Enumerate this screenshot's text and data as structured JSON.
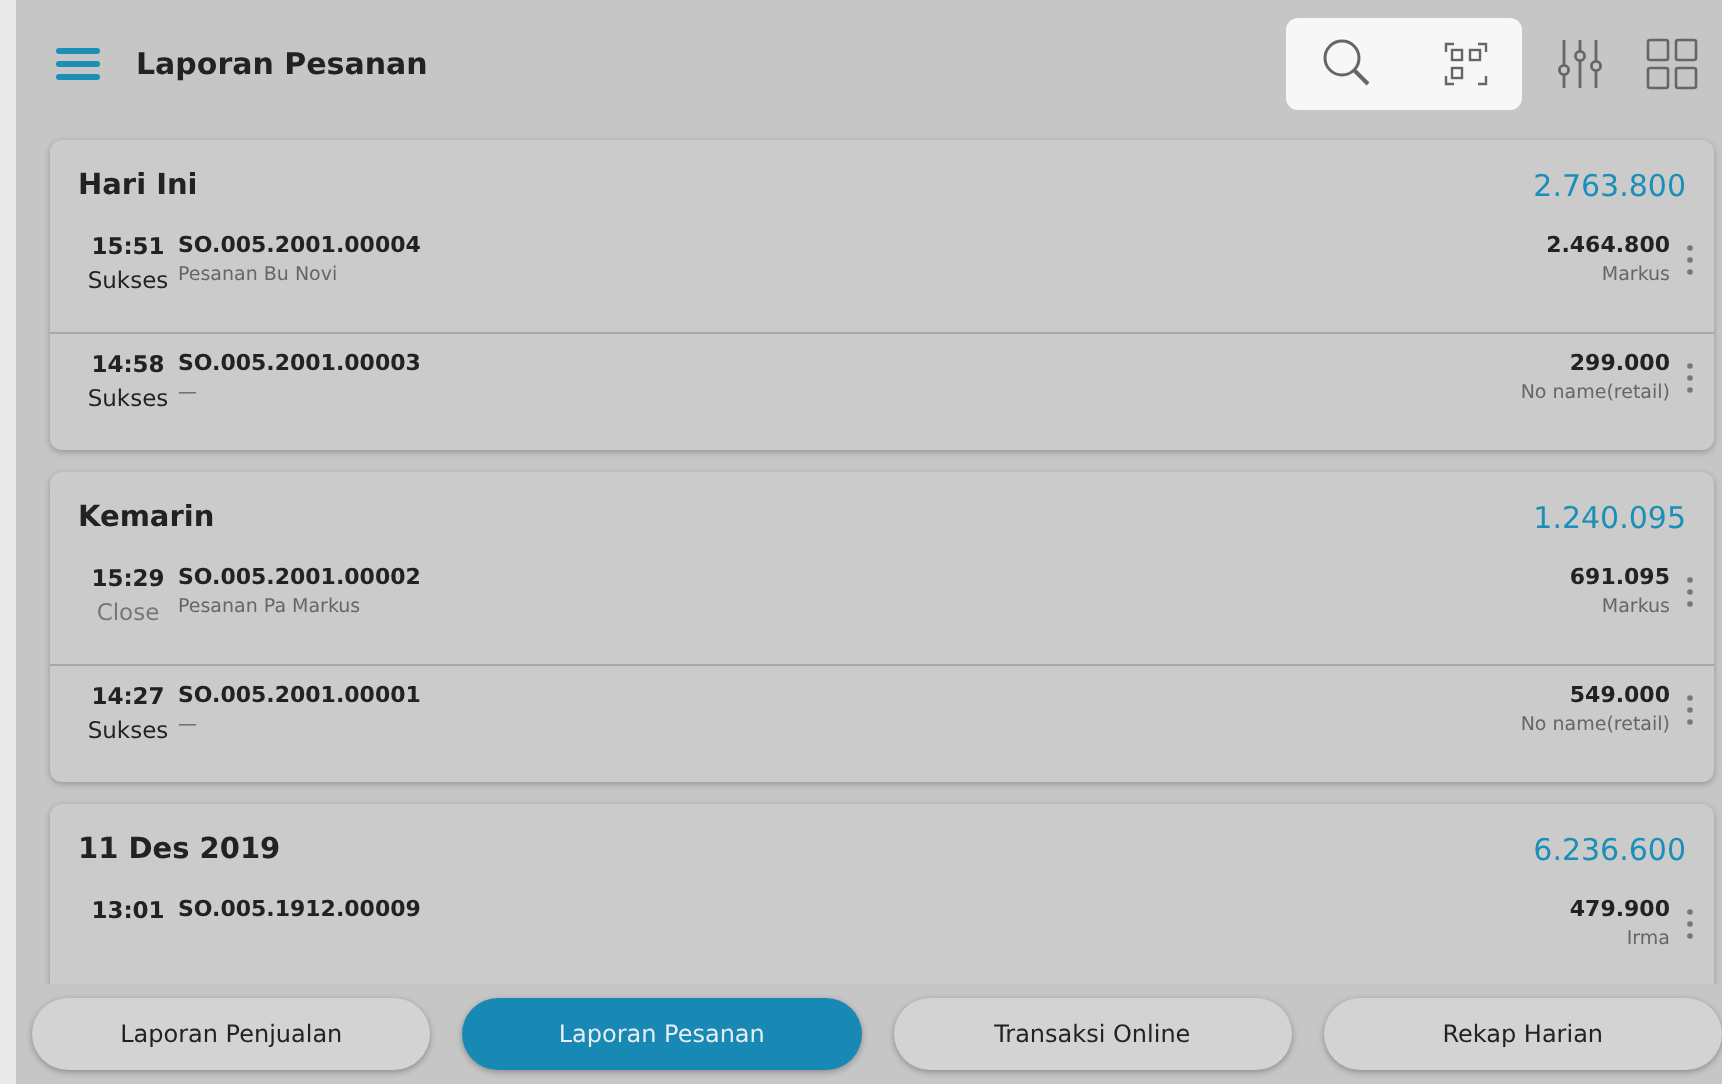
{
  "header": {
    "title": "Laporan Pesanan"
  },
  "groups": [
    {
      "title": "Hari Ini",
      "total": "2.763.800",
      "orders": [
        {
          "time": "15:51",
          "status": "Sukses",
          "kind": "done",
          "code": "SO.005.2001.00004",
          "note": "Pesanan Bu Novi",
          "amount": "2.464.800",
          "customer": "Markus"
        },
        {
          "time": "14:58",
          "status": "Sukses",
          "kind": "done",
          "code": "SO.005.2001.00003",
          "note": "—",
          "amount": "299.000",
          "customer": "No name(retail)"
        }
      ]
    },
    {
      "title": "Kemarin",
      "total": "1.240.095",
      "orders": [
        {
          "time": "15:29",
          "status": "Close",
          "kind": "closed",
          "code": "SO.005.2001.00002",
          "note": "Pesanan Pa Markus",
          "amount": "691.095",
          "customer": "Markus"
        },
        {
          "time": "14:27",
          "status": "Sukses",
          "kind": "done",
          "code": "SO.005.2001.00001",
          "note": "—",
          "amount": "549.000",
          "customer": "No name(retail)"
        }
      ]
    },
    {
      "title": "11 Des 2019",
      "total": "6.236.600",
      "orders": [
        {
          "time": "13:01",
          "code": "SO.005.1912.00009",
          "amount": "479.900",
          "customer": "Irma"
        }
      ]
    }
  ],
  "bottom_tabs": [
    {
      "label": "Laporan Penjualan",
      "selected": false
    },
    {
      "label": "Laporan Pesanan",
      "selected": true
    },
    {
      "label": "Transaksi Online",
      "selected": false
    },
    {
      "label": "Rekap Harian",
      "selected": false
    }
  ]
}
